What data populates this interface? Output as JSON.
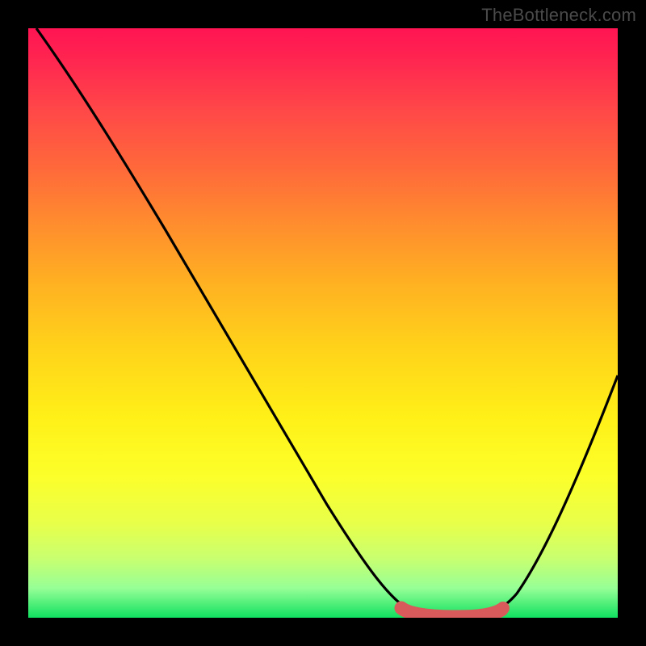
{
  "attribution": "TheBottleneck.com",
  "chart_data": {
    "type": "line",
    "title": "",
    "xlabel": "",
    "ylabel": "",
    "xlim": [
      0,
      100
    ],
    "ylim": [
      0,
      100
    ],
    "series": [
      {
        "name": "bottleneck-curve",
        "x": [
          0,
          8,
          16,
          24,
          32,
          40,
          48,
          56,
          62,
          66,
          70,
          74,
          78,
          82,
          88,
          94,
          100
        ],
        "values": [
          100,
          92,
          82,
          71,
          59,
          47,
          35,
          22,
          10,
          3,
          0,
          0,
          0,
          4,
          16,
          32,
          50
        ]
      },
      {
        "name": "optimal-band",
        "x": [
          62,
          66,
          70,
          74,
          78,
          80
        ],
        "values": [
          1.5,
          0.6,
          0.3,
          0.3,
          0.6,
          1.5
        ]
      }
    ],
    "gradient_stops": [
      {
        "pos": 0,
        "color": "#ff1452"
      },
      {
        "pos": 14,
        "color": "#ff4848"
      },
      {
        "pos": 33,
        "color": "#ff8c2e"
      },
      {
        "pos": 54,
        "color": "#ffd21a"
      },
      {
        "pos": 76,
        "color": "#fcff2a"
      },
      {
        "pos": 95,
        "color": "#96ff96"
      },
      {
        "pos": 100,
        "color": "#10e060"
      }
    ]
  }
}
